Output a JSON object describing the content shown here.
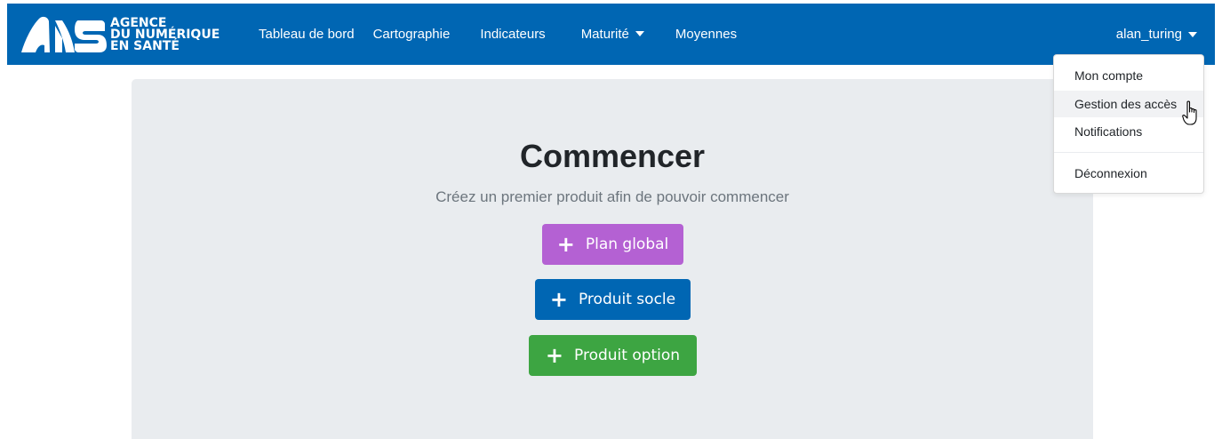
{
  "brand": {
    "line1": "AGENCE",
    "line2": "DU NUMÉRIQUE",
    "line3": "EN SANTÉ",
    "logo_icon": "ans-logo-icon"
  },
  "nav": {
    "items": [
      {
        "label": "Tableau de bord"
      },
      {
        "label": "Cartographie"
      },
      {
        "label": "Indicateurs"
      },
      {
        "label": "Maturité"
      },
      {
        "label": "Moyennes"
      }
    ],
    "user": "alan_turing"
  },
  "dropdown": {
    "items": [
      {
        "label": "Mon compte"
      },
      {
        "label": "Gestion des accès"
      },
      {
        "label": "Notifications"
      },
      {
        "label": "Déconnexion"
      }
    ],
    "hovered_item": "Gestion des accès"
  },
  "main": {
    "title": "Commencer",
    "lead": "Créez un premier produit afin de pouvoir commencer",
    "buttons": [
      {
        "label": "Plan global",
        "icon": "plus-icon",
        "color": "#b461d3"
      },
      {
        "label": "Produit socle",
        "icon": "plus-icon",
        "color": "#0066b3"
      },
      {
        "label": "Produit option",
        "icon": "plus-icon",
        "color": "#3da542"
      }
    ]
  },
  "colors": {
    "navbar": "#0066b3",
    "jumbotron": "#e9ecef"
  }
}
